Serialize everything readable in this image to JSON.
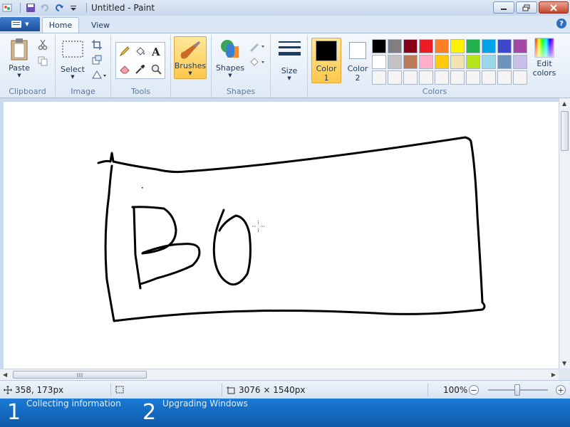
{
  "window": {
    "title": "Untitled - Paint"
  },
  "tabs": [
    {
      "label": "Home",
      "active": true
    },
    {
      "label": "View",
      "active": false
    }
  ],
  "ribbon": {
    "clipboard": {
      "group_label": "Clipboard",
      "paste_label": "Paste"
    },
    "image": {
      "group_label": "Image",
      "select_label": "Select"
    },
    "tools": {
      "group_label": "Tools"
    },
    "brushes": {
      "label": "Brushes"
    },
    "shapes": {
      "group_label": "Shapes",
      "shapes_label": "Shapes"
    },
    "size": {
      "label": "Size"
    },
    "colors": {
      "group_label": "Colors",
      "color1_label": "Color",
      "color1_num": "1",
      "color2_label": "Color",
      "color2_num": "2",
      "color1_value": "#000000",
      "color2_value": "#ffffff",
      "edit_label": "Edit",
      "edit_label2": "colors",
      "palette_row1": [
        "#000000",
        "#7f7f7f",
        "#880015",
        "#ed1c24",
        "#ff7f27",
        "#fff200",
        "#22b14c",
        "#00a2e8",
        "#3f48cc",
        "#a349a4"
      ],
      "palette_row2": [
        "#ffffff",
        "#c3c3c3",
        "#b97a57",
        "#ffaec9",
        "#ffc90e",
        "#efe4b0",
        "#b5e61d",
        "#99d9ea",
        "#7092be",
        "#c8bfe7"
      ],
      "palette_row3": [
        "#f5f5f5",
        "#f5f5f5",
        "#f5f5f5",
        "#f5f5f5",
        "#f5f5f5",
        "#f5f5f5",
        "#f5f5f5",
        "#f5f5f5",
        "#f5f5f5",
        "#f5f5f5"
      ]
    }
  },
  "status": {
    "cursor_pos": "358, 173px",
    "image_size": "3076 × 1540px",
    "zoom": "100%"
  },
  "setup": {
    "steps": [
      {
        "num": "1",
        "label": "Collecting information"
      },
      {
        "num": "2",
        "label": "Upgrading Windows"
      }
    ]
  }
}
